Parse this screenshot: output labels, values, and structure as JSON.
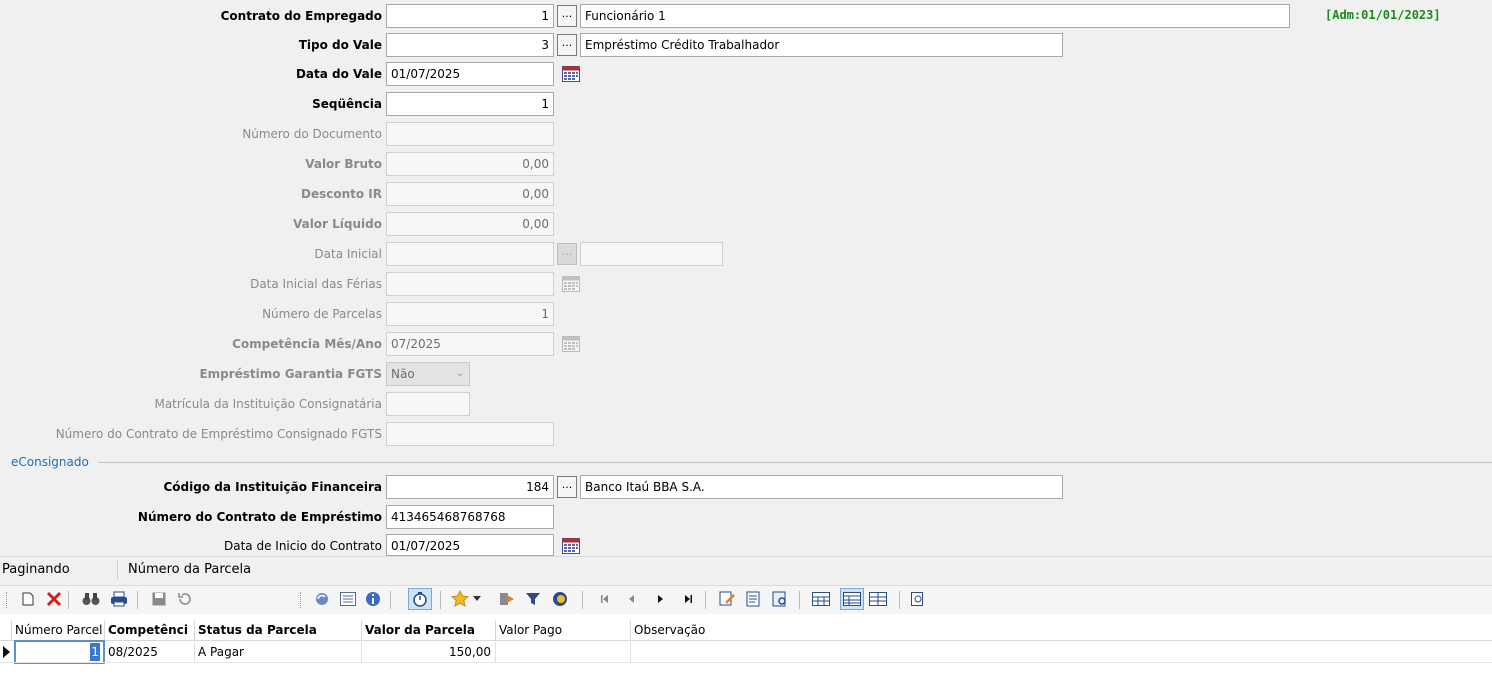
{
  "form": {
    "contrato_label": "Contrato do Empregado",
    "contrato_code": "1",
    "contrato_name": "Funcionário 1",
    "adm": "[Adm:01/01/2023]",
    "tipo_label": "Tipo do Vale",
    "tipo_code": "3",
    "tipo_name": "Empréstimo Crédito Trabalhador",
    "data_label": "Data do Vale",
    "data_value": "01/07/2025",
    "sequencia_label": "Seqüência",
    "sequencia_value": "1",
    "num_doc_label": "Número do Documento",
    "num_doc_value": "",
    "valor_bruto_label": "Valor Bruto",
    "valor_bruto_value": "0,00",
    "desconto_label": "Desconto IR",
    "desconto_value": "0,00",
    "liquido_label": "Valor Líquido",
    "liquido_value": "0,00",
    "data_inicial_label": "Data Inicial",
    "data_ferias_label": "Data Inicial das Férias",
    "num_parcelas_label": "Número de Parcelas",
    "num_parcelas_value": "1",
    "competencia_label": "Competência Mês/Ano",
    "competencia_value": "07/2025",
    "fgts_label": "Empréstimo Garantia FGTS",
    "fgts_value": "Não",
    "matricula_label": "Matrícula da Instituição Consignatária",
    "num_contrato_fgts_label": "Número do Contrato de Empréstimo Consignado FGTS",
    "econsignado_group": "eConsignado",
    "inst_label": "Código da Instituição Financeira",
    "inst_code": "184",
    "inst_name": "Banco Itaú BBA S.A.",
    "contrato_emp_label": "Número do Contrato de Empréstimo",
    "contrato_emp_value": "413465468768768",
    "data_inicio_label": "Data de Inicio do Contrato",
    "data_inicio_value": "01/07/2025",
    "ellipsis": "..."
  },
  "paging": {
    "label": "Paginando",
    "field": "Número da Parcela"
  },
  "grid": {
    "headers": [
      "Número Parcel",
      "Competênci",
      "Status da Parcela",
      "Valor da Parcela",
      "Valor Pago",
      "Observação"
    ],
    "rows": [
      [
        "1",
        "08/2025",
        "A Pagar",
        "150,00",
        "",
        ""
      ]
    ]
  },
  "colors": {
    "adm_green": "#1a8a1a",
    "group_blue": "#1f6fb5"
  }
}
